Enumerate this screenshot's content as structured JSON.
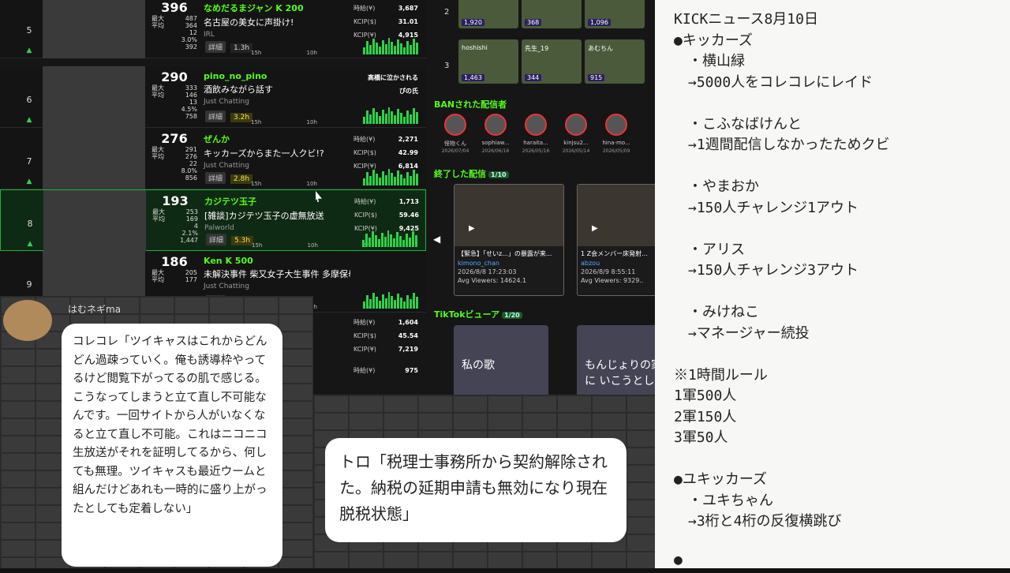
{
  "ranking": [
    {
      "rank": "5",
      "score": "396",
      "name": "なめだるまジャン",
      "badge": "K",
      "followers": "200",
      "title": "名古屋の美女に声掛け!",
      "category": "IRL",
      "stats": [
        [
          "最大",
          "487"
        ],
        [
          "平均",
          "364"
        ],
        [
          "",
          "12"
        ],
        [
          "",
          "3.0%"
        ],
        [
          "",
          "392"
        ]
      ],
      "duration": "1.3h",
      "kcip": [
        [
          "時給(¥)",
          "3,687"
        ],
        [
          "KCIP($)",
          "31.01"
        ],
        [
          "KCIP(¥)",
          "4,915"
        ]
      ],
      "highlight": false,
      "dur_style": "n"
    },
    {
      "rank": "6",
      "score": "290",
      "name": "pino_no_pino",
      "badge": "",
      "followers": "",
      "title": "酒飲みながら話す",
      "category": "Just Chatting",
      "stats": [
        [
          "最大",
          "333"
        ],
        [
          "平均",
          "146"
        ],
        [
          "",
          "13"
        ],
        [
          "",
          "4.5%"
        ],
        [
          "",
          "758"
        ]
      ],
      "duration": "3.2h",
      "kcip": [
        [
          "",
          "高橋に泣かされる"
        ],
        [
          "",
          "ぴの氏"
        ],
        [
          "",
          ""
        ]
      ],
      "highlight": false,
      "dur_style": "y"
    },
    {
      "rank": "7",
      "score": "276",
      "name": "ぜんか",
      "badge": "",
      "followers": "",
      "title": "キッカーズからまた一人クビ!?",
      "category": "Just Chatting",
      "stats": [
        [
          "最大",
          "291"
        ],
        [
          "平均",
          "276"
        ],
        [
          "",
          "22"
        ],
        [
          "",
          "8.0%"
        ],
        [
          "",
          "856"
        ]
      ],
      "duration": "2.8h",
      "kcip": [
        [
          "時給(¥)",
          "2,271"
        ],
        [
          "KCIP($)",
          "42.99"
        ],
        [
          "KCIP(¥)",
          "6,814"
        ]
      ],
      "highlight": false,
      "dur_style": "y"
    },
    {
      "rank": "8",
      "score": "193",
      "name": "カジテツ玉子",
      "badge": "",
      "followers": "",
      "title": "[雑談]カジテツ玉子の虚無放送",
      "category": "Palworld",
      "stats": [
        [
          "最大",
          "253"
        ],
        [
          "平均",
          "169"
        ],
        [
          "",
          "4"
        ],
        [
          "",
          "2.1%"
        ],
        [
          "",
          "1,447"
        ]
      ],
      "duration": "5.3h",
      "kcip": [
        [
          "時給(¥)",
          "1,713"
        ],
        [
          "KCIP($)",
          "59.46"
        ],
        [
          "KCIP(¥)",
          "9,425"
        ]
      ],
      "highlight": true,
      "dur_style": "y"
    },
    {
      "rank": "9",
      "score": "186",
      "name": "Ken",
      "badge": "K",
      "followers": "500",
      "title": "未解決事件 柴又女子大生事件 多摩保母マンホール事件",
      "category": "Just Chatting",
      "stats": [
        [
          "最大",
          "205"
        ],
        [
          "平均",
          "177"
        ],
        [
          "",
          ""
        ],
        [
          "",
          ""
        ],
        [
          "",
          ""
        ]
      ],
      "duration": "",
      "kcip": [
        [
          "",
          ""
        ],
        [
          "",
          ""
        ],
        [
          "",
          ""
        ]
      ],
      "highlight": false,
      "dur_style": "n"
    }
  ],
  "rank_top": {
    "rank1": "1",
    "rank2": "3",
    "count1": "4"
  },
  "extra_kcip": [
    [
      "時給(¥)",
      "1,604"
    ],
    [
      "KCIP($)",
      "45.54"
    ],
    [
      "KCIP(¥)",
      "7,219"
    ],
    [
      "時給(¥)",
      "975"
    ]
  ],
  "timeline": {
    "a": "15h",
    "b": "10h",
    "c": "5h"
  },
  "detail_label": "詳細",
  "top_grid": {
    "rows": [
      {
        "no": "2",
        "cells": [
          {
            "n": "",
            "v": "1,920"
          },
          {
            "n": "",
            "v": "368"
          },
          {
            "n": "",
            "v": "1,096"
          }
        ]
      },
      {
        "no": "3",
        "cells": [
          {
            "n": "hoshishi",
            "v": "1,463"
          },
          {
            "n": "先生_19",
            "v": "344"
          },
          {
            "n": "あむちん",
            "v": "915"
          }
        ]
      }
    ]
  },
  "banned": {
    "title": "BANされた配信者",
    "users": [
      {
        "n": "怪物くん",
        "d": "2026/07/04"
      },
      {
        "n": "sophiaw...",
        "d": "2026/06/16"
      },
      {
        "n": "haraita...",
        "d": "2026/05/16"
      },
      {
        "n": "kinjsu2...",
        "d": "2026/05/14"
      },
      {
        "n": "hina-mo...",
        "d": "2026/05/09"
      }
    ]
  },
  "ended": {
    "title": "終了した配信",
    "count": "1/10",
    "videos": [
      {
        "t": "【緊急】「せいz...」の暴露が来...",
        "u": "kimono_chan",
        "d": "2026/8/8 17:23:03",
        "v": "Avg Viewers: 14624.1"
      },
      {
        "t": "1 Z会メンバー床発射...",
        "u": "abzou",
        "d": "2026/8/9 8:55:11",
        "v": "Avg Viewers: 9329.."
      }
    ]
  },
  "tiktok": {
    "title": "TikTokビューア",
    "count": "1/20",
    "items": [
      {
        "t": "私の歌"
      },
      {
        "t": "もんじょりの家に いこうとし"
      }
    ]
  },
  "note_lines": [
    "KICKニュース8月10日",
    "●キッカーズ",
    "　・横山緑",
    "　→5000人をコレコレにレイド",
    "",
    "　・こふなばけんと",
    "　→1週間配信しなかったためクビ",
    "",
    "　・やまおか",
    "　→150人チャレンジ1アウト",
    "",
    "　・アリス",
    "　→150人チャレンジ3アウト",
    "",
    "　・みけねこ",
    "　→マネージャー続投",
    "",
    "※1時間ルール",
    "1軍500人",
    "2軍150人",
    "3軍50人",
    "",
    "●ユキッカーズ",
    "　・ユキちゃん",
    "　→3桁と4桁の反復横跳び",
    "",
    "●"
  ],
  "comment1": {
    "user": "はむネギma",
    "text": "コレコレ「ツイキャスはこれからどんどん過疎っていく。俺も誘導枠やってるけど閲覧下がってるの肌で感じる。こうなってしまうと立て直し不可能なんです。一回サイトから人がいなくなると立て直し不可能。これはニコニコ生放送がそれを証明してるから、何しても無理。ツイキャスも最近ウームと組んだけどあれも一時的に盛り上がったとしても定着しない」"
  },
  "comment2": {
    "text": "トロ「税理士事務所から契約解除された。納税の延期申請も無効になり現在脱税状態」"
  },
  "colors": {
    "kick_green": "#53fc18",
    "accent_bar": "#2ed14a",
    "ban_ring": "#e33"
  }
}
